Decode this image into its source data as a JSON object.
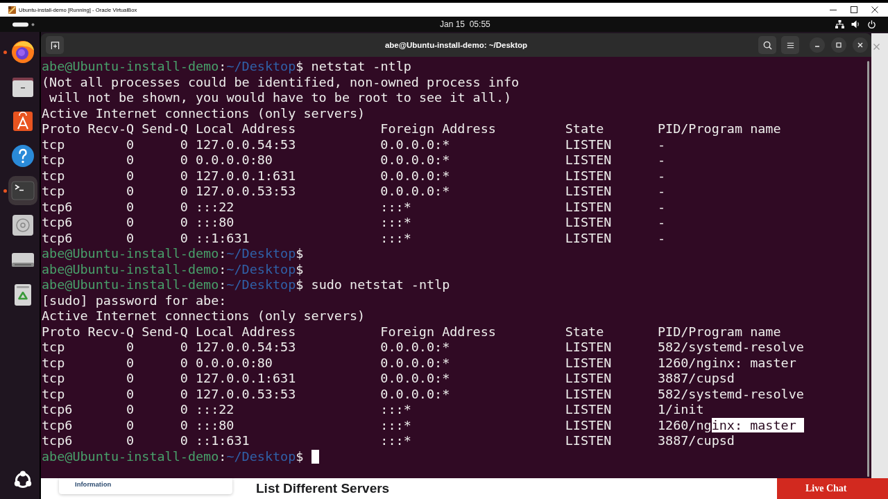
{
  "host_window": {
    "title": "Ubuntu-install-demo [Running] - Oracle VirtualBox"
  },
  "top_bar": {
    "clock": "Jan 15  05:55"
  },
  "dock": {
    "items": [
      {
        "kind": "browser",
        "running": true,
        "selected": false
      },
      {
        "kind": "files",
        "running": false,
        "selected": false
      },
      {
        "kind": "app_store",
        "running": false,
        "selected": false
      },
      {
        "kind": "help",
        "running": false,
        "selected": false
      },
      {
        "kind": "terminal",
        "running": true,
        "selected": true
      },
      {
        "kind": "disc",
        "running": false,
        "selected": false
      },
      {
        "kind": "drive",
        "running": false,
        "selected": false
      },
      {
        "kind": "trash",
        "running": false,
        "selected": false
      }
    ]
  },
  "terminal": {
    "title": "abe@Ubuntu-install-demo: ~/Desktop",
    "lines": [
      {
        "kind": "prompt",
        "user": "abe@Ubuntu-install-demo",
        "separator": ":",
        "path": "~/Desktop",
        "symbol": "$",
        "command": "netstat -ntlp",
        "cursor": false
      },
      {
        "kind": "text",
        "text": "(Not all processes could be identified, non-owned process info"
      },
      {
        "kind": "text",
        "text": " will not be shown, you would have to be root to see it all.)"
      },
      {
        "kind": "text",
        "text": "Active Internet connections (only servers)"
      },
      {
        "kind": "table",
        "columns": [
          "Proto",
          "Recv-Q",
          "Send-Q",
          "Local Address",
          "Foreign Address",
          "State",
          "PID/Program name"
        ],
        "rows": [
          [
            "tcp",
            "0",
            "0",
            "127.0.0.54:53",
            "0.0.0.0:*",
            "LISTEN",
            "-"
          ],
          [
            "tcp",
            "0",
            "0",
            "0.0.0.0:80",
            "0.0.0.0:*",
            "LISTEN",
            "-"
          ],
          [
            "tcp",
            "0",
            "0",
            "127.0.0.1:631",
            "0.0.0.0:*",
            "LISTEN",
            "-"
          ],
          [
            "tcp",
            "0",
            "0",
            "127.0.0.53:53",
            "0.0.0.0:*",
            "LISTEN",
            "-"
          ],
          [
            "tcp6",
            "0",
            "0",
            ":::22",
            ":::*",
            "LISTEN",
            "-"
          ],
          [
            "tcp6",
            "0",
            "0",
            ":::80",
            ":::*",
            "LISTEN",
            "-"
          ],
          [
            "tcp6",
            "0",
            "0",
            "::1:631",
            ":::*",
            "LISTEN",
            "-"
          ]
        ]
      },
      {
        "kind": "prompt",
        "user": "abe@Ubuntu-install-demo",
        "separator": ":",
        "path": "~/Desktop",
        "symbol": "$",
        "cursor": false
      },
      {
        "kind": "prompt",
        "user": "abe@Ubuntu-install-demo",
        "separator": ":",
        "path": "~/Desktop",
        "symbol": "$",
        "cursor": false
      },
      {
        "kind": "prompt",
        "user": "abe@Ubuntu-install-demo",
        "separator": ":",
        "path": "~/Desktop",
        "symbol": "$",
        "command": "sudo netstat -ntlp",
        "cursor": false
      },
      {
        "kind": "text",
        "text": "[sudo] password for abe:"
      },
      {
        "kind": "text",
        "text": "Active Internet connections (only servers)"
      },
      {
        "kind": "table",
        "columns": [
          "Proto",
          "Recv-Q",
          "Send-Q",
          "Local Address",
          "Foreign Address",
          "State",
          "PID/Program name"
        ],
        "rows": [
          [
            "tcp",
            "0",
            "0",
            "127.0.0.54:53",
            "0.0.0.0:*",
            "LISTEN",
            "582/systemd-resolve"
          ],
          [
            "tcp",
            "0",
            "0",
            "0.0.0.0:80",
            "0.0.0.0:*",
            "LISTEN",
            "1260/nginx: master"
          ],
          [
            "tcp",
            "0",
            "0",
            "127.0.0.1:631",
            "0.0.0.0:*",
            "LISTEN",
            "3887/cupsd"
          ],
          [
            "tcp",
            "0",
            "0",
            "127.0.0.53:53",
            "0.0.0.0:*",
            "LISTEN",
            "582/systemd-resolve"
          ],
          [
            "tcp6",
            "0",
            "0",
            ":::22",
            ":::*",
            "LISTEN",
            "1/init"
          ],
          [
            "tcp6",
            "0",
            "0",
            ":::80",
            ":::*",
            "LISTEN",
            [
              {
                "text": "1260/ng",
                "selected": false
              },
              {
                "text": "inx: master",
                "selected": true
              }
            ]
          ],
          [
            "tcp6",
            "0",
            "0",
            "::1:631",
            ":::*",
            "LISTEN",
            "3887/cupsd"
          ]
        ]
      },
      {
        "kind": "prompt",
        "user": "abe@Ubuntu-install-demo",
        "separator": ":",
        "path": "~/Desktop",
        "symbol": "$",
        "cursor": true
      }
    ]
  },
  "web_page": {
    "tab": "Information",
    "heading": "List Different Servers",
    "chat_button": "Live Chat"
  }
}
